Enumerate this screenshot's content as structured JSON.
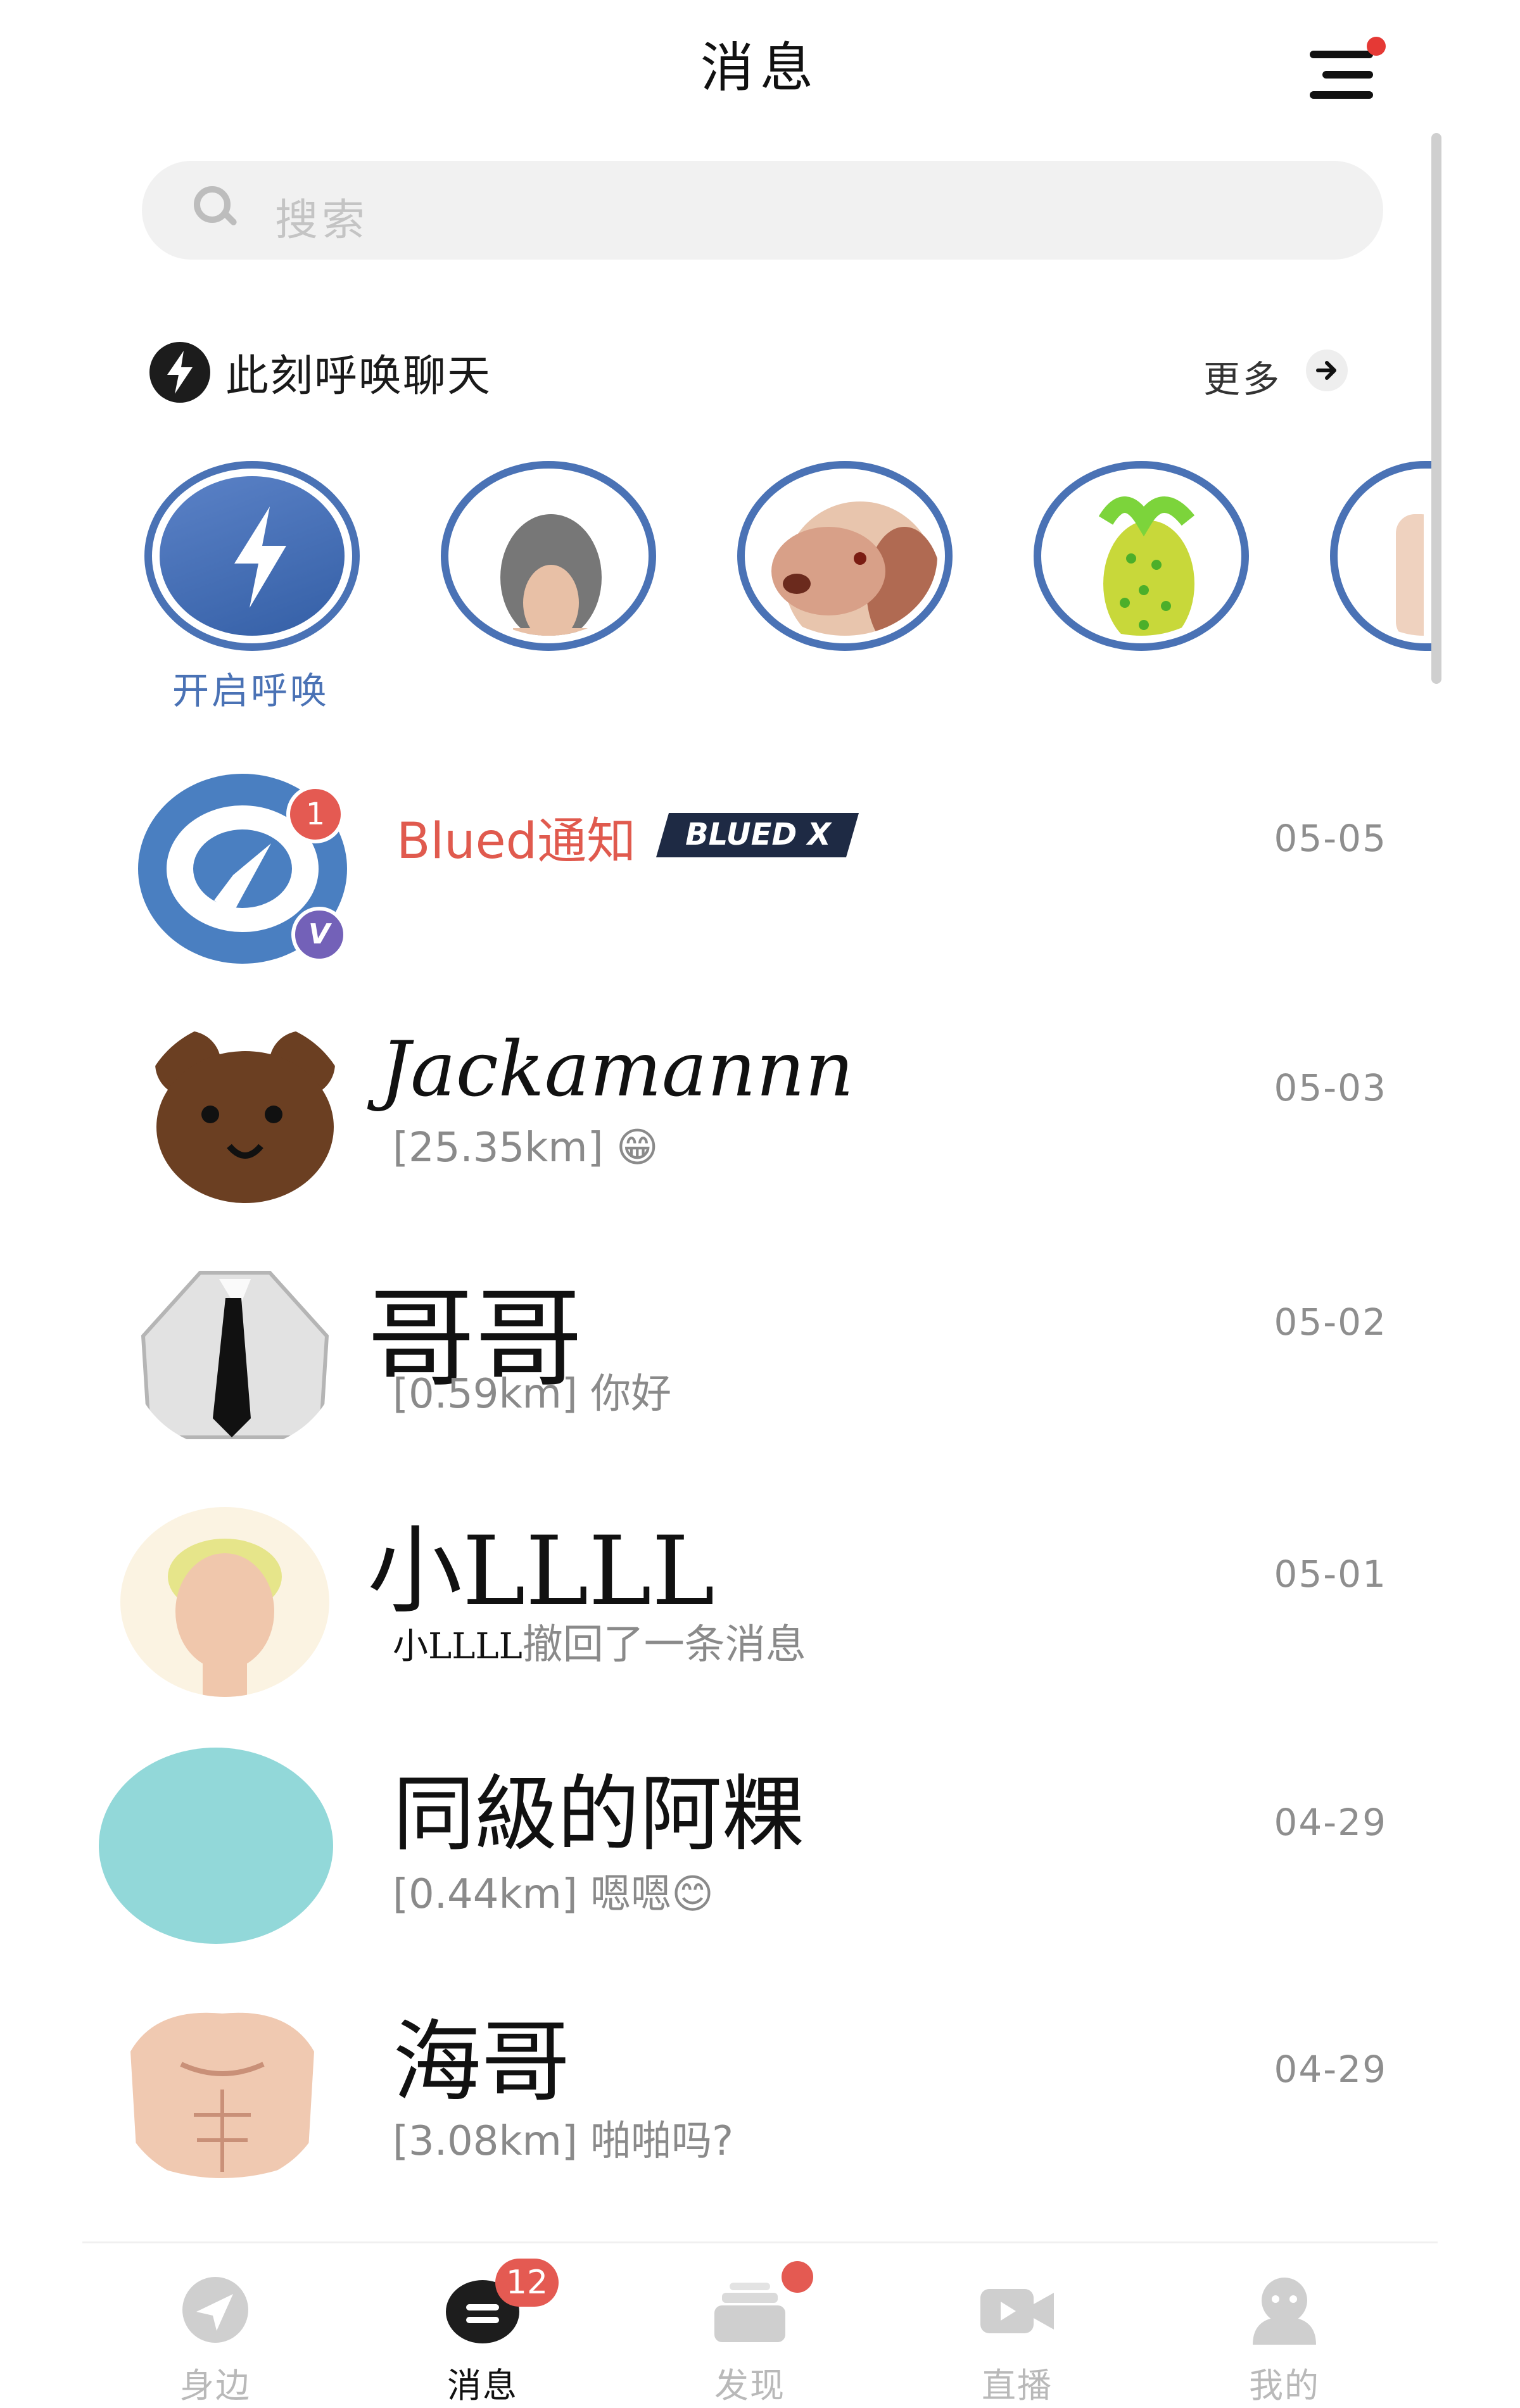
{
  "header": {
    "title": "消息",
    "menu_has_notification": true
  },
  "search": {
    "placeholder": "搜索"
  },
  "summon": {
    "title": "此刻呼唤聊天",
    "more_label": "更多",
    "open_label": "开启呼唤"
  },
  "conversations": [
    {
      "name": "Blued通知",
      "badge_text": "BLUED X",
      "unread_count": "1",
      "verified_mark": "V",
      "message": "",
      "date": "05-05"
    },
    {
      "name": "Jackamannn",
      "message": "[25.35km] 😁",
      "date": "05-03"
    },
    {
      "name": "哥哥",
      "message": "[0.59km] 你好",
      "date": "05-02"
    },
    {
      "name": "小LLLL",
      "recaller": "小LLLL",
      "message": "撤回了一条消息",
      "date": "05-01"
    },
    {
      "name": "同級的阿粿",
      "message": "[0.44km] 嗯嗯😊",
      "date": "04-29"
    },
    {
      "name": "海哥",
      "message": "[3.08km] 啪啪吗?",
      "date": "04-29"
    }
  ],
  "tabs": [
    {
      "label": "身边",
      "icon": "location-arrow-icon"
    },
    {
      "label": "消息",
      "icon": "chat-bubble-icon",
      "badge": "12",
      "active": true
    },
    {
      "label": "发现",
      "icon": "cards-icon",
      "dot": true
    },
    {
      "label": "直播",
      "icon": "video-camera-icon"
    },
    {
      "label": "我的",
      "icon": "person-icon"
    }
  ],
  "colors": {
    "accent_blue": "#4a72b5",
    "notification_red": "#e53935",
    "notice_name": "#e05a4e"
  }
}
